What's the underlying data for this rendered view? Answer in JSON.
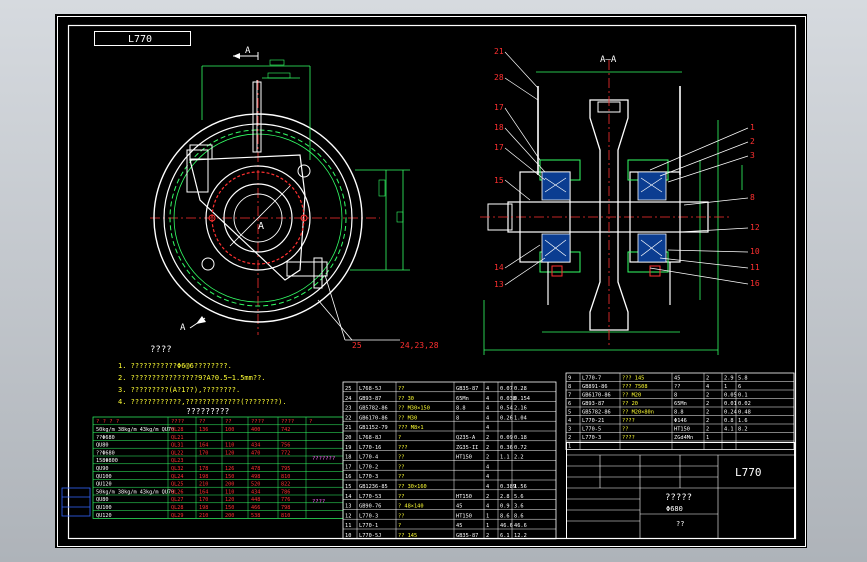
{
  "drawing": {
    "code_box": "L770",
    "section_label": "A–A",
    "view_label_a_top": "A",
    "view_label_a_bottom": "A",
    "center_label": "A",
    "balloon_leader": "24,23,28",
    "balloon_25": "25",
    "notes_title": "????",
    "notes": [
      "1. ???????????Φ6@6????????.",
      "2. ????????????????9?A?0.5~1.5mm??.",
      "3. ?????????(A?1??),????????.",
      "4. ????????????,?????????????(????????)."
    ],
    "perf_table_title": "?????????",
    "perf_header": [
      "? ? ? ?",
      "????",
      "??",
      "??",
      "????",
      "????",
      "?"
    ],
    "perf_rows": [
      [
        "50kg/m 38kg/m 43kg/m QU70",
        "QL28",
        "136",
        "100",
        "400",
        "742"
      ],
      [
        "??Φ680",
        "QL21",
        "",
        "",
        "",
        ""
      ],
      [
        "QU80",
        "QL31",
        "164",
        "110",
        "434",
        "756"
      ],
      [
        "??Φ680",
        "QL22",
        "170",
        "120",
        "470",
        "772"
      ],
      [
        "158Φ800",
        "QL23",
        "",
        "",
        "",
        ""
      ],
      [
        "QU90",
        "QL32",
        "178",
        "126",
        "478",
        "795"
      ],
      [
        "QU100",
        "QL24",
        "198",
        "150",
        "498",
        "810"
      ],
      [
        "QU120",
        "QL25",
        "210",
        "200",
        "520",
        "822"
      ],
      [
        "50kg/m 38kg/m 43kg/m QU70",
        "QL26",
        "164",
        "110",
        "434",
        "786"
      ],
      [
        "QU80",
        "QL27",
        "170",
        "120",
        "448",
        "776"
      ],
      [
        "QU100",
        "QL28",
        "198",
        "150",
        "466",
        "798"
      ],
      [
        "QU120",
        "QL29",
        "210",
        "200",
        "538",
        "810"
      ]
    ],
    "perf_side_note_1": "???????",
    "perf_side_note_2": "????",
    "bom_rows_left": [
      [
        "25",
        "L768-5J",
        "??",
        "GB35-87",
        "4",
        "0.07",
        "0.28"
      ],
      [
        "24",
        "GB93-87",
        "?? 30",
        "65Mn",
        "4",
        "0.038",
        "0.154"
      ],
      [
        "23",
        "GB5782-86",
        "?? M30×150",
        "8.8",
        "4",
        "0.54",
        "2.16"
      ],
      [
        "22",
        "GB6170-86",
        "?? M30",
        "8",
        "4",
        "0.26",
        "1.04"
      ],
      [
        "21",
        "GB1152-79",
        "??? M8×1",
        "",
        "4",
        "",
        ""
      ],
      [
        "20",
        "L768-8J",
        "?",
        "Q235-A",
        "2",
        "0.09",
        "0.18"
      ],
      [
        "19",
        "L770-16",
        "???",
        "ZG35-II",
        "2",
        "0.36",
        "0.72"
      ],
      [
        "18",
        "L770-4",
        "??",
        "HT150",
        "2",
        "1.1",
        "2.2"
      ],
      [
        "17",
        "L770-2",
        "??",
        "",
        "4",
        "",
        ""
      ],
      [
        "16",
        "L770-3",
        "??",
        "",
        "4",
        "",
        ""
      ],
      [
        "15",
        "GB1236-85",
        "?? 30×160",
        "",
        "4",
        "0.389",
        "1.56"
      ],
      [
        "14",
        "L770-53",
        "??",
        "HT150",
        "2",
        "2.8",
        "5.6"
      ],
      [
        "13",
        "GB90-76",
        "? 48×140",
        "45",
        "4",
        "0.9",
        "3.6"
      ],
      [
        "12",
        "L770-3",
        "??",
        "HT150",
        "1",
        "8.6",
        "8.6"
      ],
      [
        "11",
        "L770-1",
        "?",
        "45",
        "1",
        "46.6",
        "46.6"
      ],
      [
        "10",
        "L770-5J",
        "?? 145",
        "GB35-87",
        "2",
        "6.1",
        "12.2"
      ]
    ],
    "bom_rows_right": [
      [
        "9",
        "L770-7",
        "??? 145",
        "45",
        "2",
        "2.9",
        "5.8"
      ],
      [
        "8",
        "GB891-86",
        "??? 7508",
        "??",
        "4",
        "1",
        "6"
      ],
      [
        "7",
        "GB6170-86",
        "?? M20",
        "8",
        "2",
        "0.05",
        "0.1"
      ],
      [
        "6",
        "GB93-87",
        "?? 20",
        "65Mn",
        "2",
        "0.01",
        "0.02"
      ],
      [
        "5",
        "GB5782-86",
        "?? M20×80n",
        "8.8",
        "2",
        "0.24",
        "0.48"
      ],
      [
        "4",
        "L770-21",
        "????",
        "Φ146",
        "2",
        "0.8",
        "1.6"
      ],
      [
        "3",
        "L770-5",
        "??",
        "HT150",
        "2",
        "4.1",
        "8.2"
      ],
      [
        "2",
        "L770-3",
        "????",
        "ZGd4Mn",
        "1",
        "",
        ""
      ],
      [
        "1",
        "",
        "",
        "",
        "",
        "",
        ""
      ]
    ],
    "title_block_code": "L770",
    "title_block_name": "?????",
    "title_block_size": "Φ680",
    "title_block_unit": "??"
  }
}
